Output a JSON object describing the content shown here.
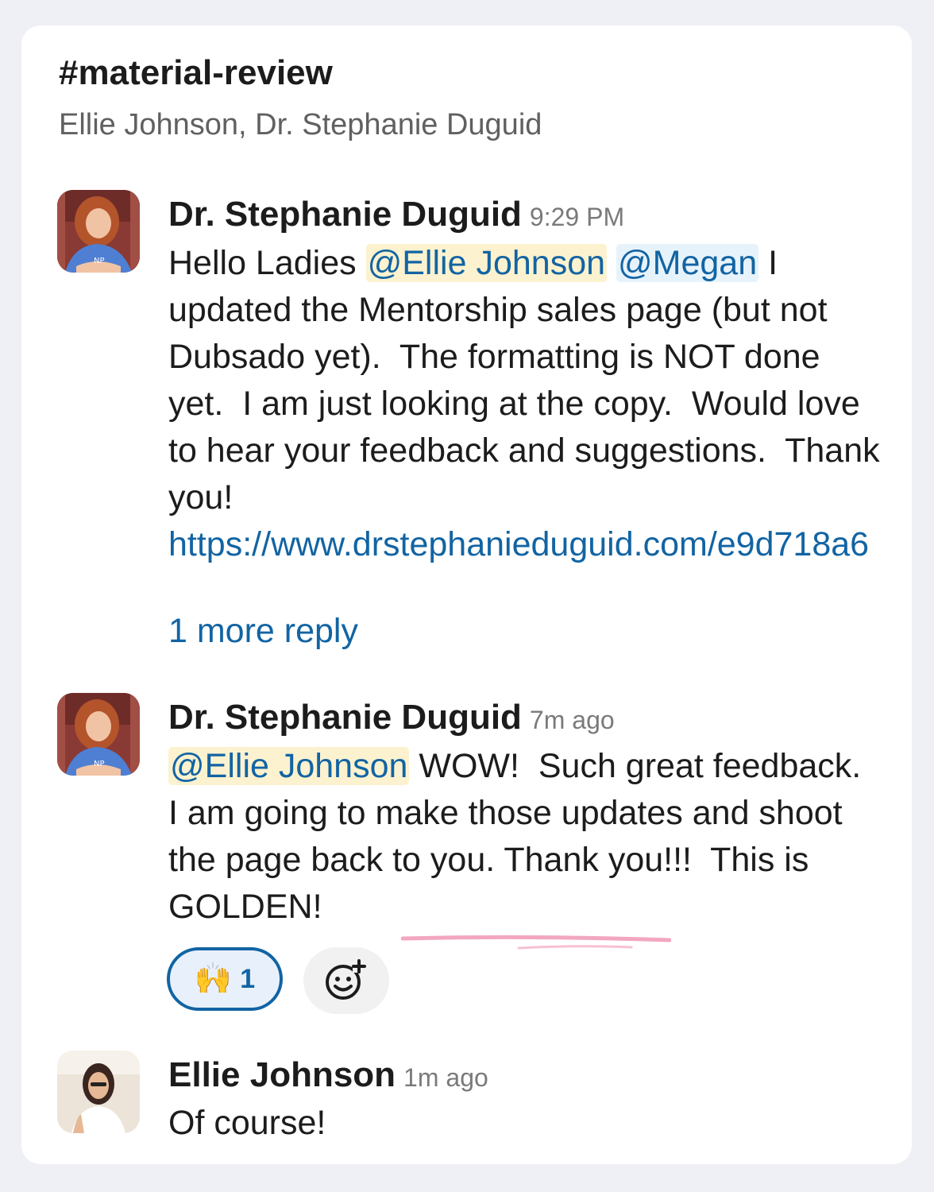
{
  "channel": {
    "title": "#material-review",
    "participants": "Ellie Johnson, Dr. Stephanie Duguid"
  },
  "messages": [
    {
      "author": "Dr. Stephanie Duguid",
      "time": "9:29 PM",
      "text_1": "Hello Ladies ",
      "mention_1": "@Ellie Johnson",
      "mention_2": "@Megan",
      "text_2": " I updated the Mentorship sales page (but not Dubsado yet).  The formatting is NOT done yet.  I am just looking at the copy.  Would love to hear your feedback and suggestions.  Thank you! ",
      "link": "https://www.drstephanieduguid.com/e9d718a6",
      "more_replies": "1 more reply"
    },
    {
      "author": "Dr. Stephanie Duguid",
      "time": "7m ago",
      "mention_1": "@Ellie Johnson",
      "text_1": " WOW!  Such great feedback.  I am going to make those updates and shoot the page back to you. Thank you!!!  This is GOLDEN!",
      "reaction": {
        "emoji": "🙌",
        "count": "1"
      }
    },
    {
      "author": "Ellie Johnson",
      "time": "1m ago",
      "text_1": "Of course!"
    }
  ],
  "icons": {
    "add_reaction": "add-reaction-icon",
    "avatar_1": "avatar-stephanie",
    "avatar_2": "avatar-stephanie",
    "avatar_3": "avatar-ellie"
  },
  "colors": {
    "link": "#1264a3",
    "mention_highlight": "#fcf2cf",
    "mention_blue": "#e7f3fb",
    "underline": "#f2a7bf"
  }
}
